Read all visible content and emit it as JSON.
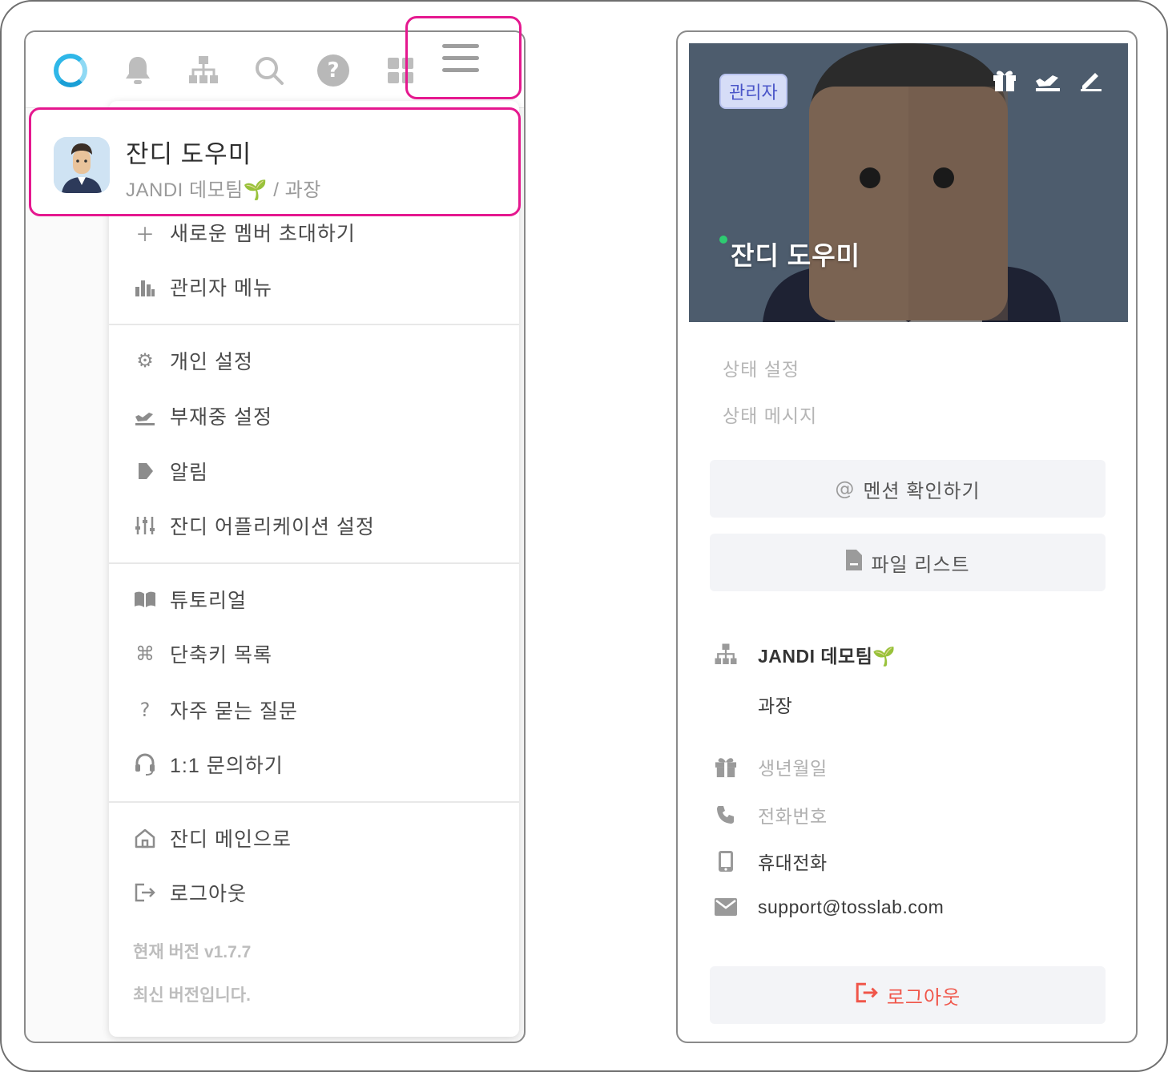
{
  "left": {
    "profile": {
      "name": "잔디 도우미",
      "team_role": "JANDI 데모팀🌱 / 과장"
    },
    "topbar_icons": [
      "logo-icon",
      "bell-icon",
      "org-chart-icon",
      "search-icon",
      "help-icon",
      "apps-grid-icon",
      "hamburger-menu-icon"
    ],
    "menu": {
      "invite": "새로운 멤버 초대하기",
      "admin_menu": "관리자 메뉴",
      "personal_settings": "개인 설정",
      "away_settings": "부재중 설정",
      "notifications": "알림",
      "app_settings": "잔디 어플리케이션 설정",
      "tutorial": "튜토리얼",
      "shortcuts": "단축키 목록",
      "faq": "자주 묻는 질문",
      "inquiry": "1:1 문의하기",
      "home": "잔디 메인으로",
      "logout": "로그아웃"
    },
    "version": {
      "current": "현재 버전 v1.7.7",
      "latest": "최신 버전입니다."
    }
  },
  "right": {
    "badge": "관리자",
    "name": "잔디 도우미",
    "status_setting": "상태 설정",
    "status_message": "상태 메시지",
    "mentions_button": "멘션 확인하기",
    "files_button": "파일 리스트",
    "team": "JANDI 데모팀🌱",
    "position": "과장",
    "birthday": "생년월일",
    "phone": "전화번호",
    "mobile": "휴대전화",
    "email": "support@tosslab.com",
    "logout_button": "로그아웃"
  },
  "colors": {
    "highlight": "#e5188f",
    "logout": "#f0564a",
    "cover_bg": "#4d5c6d",
    "admin_badge": "#4a55c8"
  }
}
